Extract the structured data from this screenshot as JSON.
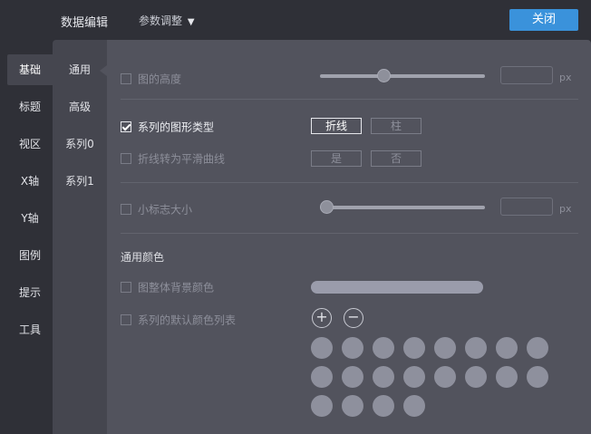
{
  "topbar": {
    "title": "数据编辑",
    "menu_label": "参数调整",
    "menu_caret": "▼",
    "close_label": "关闭"
  },
  "sidebar1": {
    "items": [
      {
        "label": "基础",
        "active": true
      },
      {
        "label": "标题"
      },
      {
        "label": "视区"
      },
      {
        "label": "X轴"
      },
      {
        "label": "Y轴"
      },
      {
        "label": "图例"
      },
      {
        "label": "提示"
      },
      {
        "label": "工具"
      }
    ]
  },
  "sidebar2": {
    "items": [
      {
        "label": "通用",
        "active": true
      },
      {
        "label": "高级"
      },
      {
        "label": "系列0"
      },
      {
        "label": "系列1"
      }
    ]
  },
  "content": {
    "chart_height": {
      "label": "图的高度",
      "checked": false,
      "value": "",
      "unit": "px",
      "slider_fraction": 0.38
    },
    "series_shape": {
      "label": "系列的图形类型",
      "checked": true,
      "options": [
        "折线",
        "柱"
      ],
      "selected": "折线"
    },
    "smooth_line": {
      "label": "折线转为平滑曲线",
      "checked": false,
      "options": [
        "是",
        "否"
      ]
    },
    "marker_size": {
      "label": "小标志大小",
      "checked": false,
      "value": "",
      "unit": "px",
      "slider_fraction": 0.0
    },
    "common_colors_title": "通用颜色",
    "bg_color": {
      "label": "图整体背景颜色",
      "checked": false,
      "color": "#9a9cab"
    },
    "default_colors": {
      "label": "系列的默认颜色列表",
      "checked": false,
      "add_symbol": "+",
      "remove_symbol": "−",
      "swatch_color": "#8e909d",
      "swatch_count": 20
    }
  },
  "colors": {
    "accent": "#3a92db",
    "panel": "#52535d",
    "sidebar": "#45464f",
    "background": "#2f3037"
  }
}
